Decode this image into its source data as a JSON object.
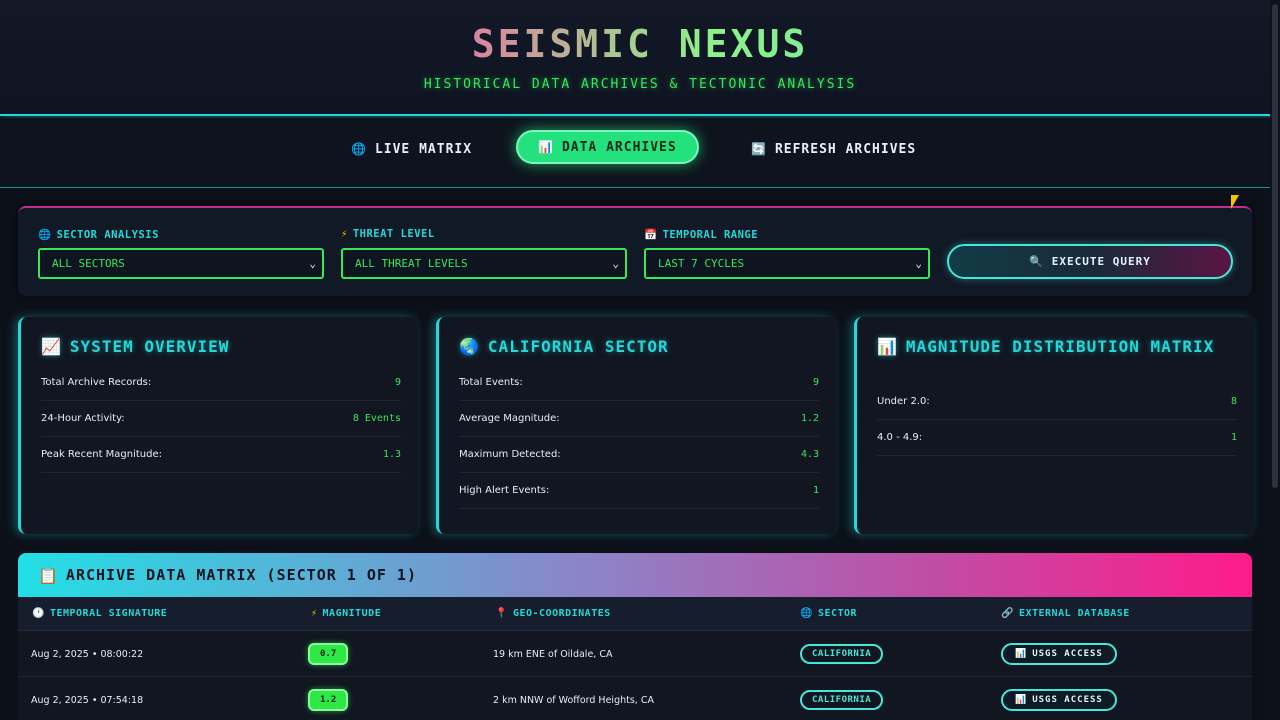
{
  "header": {
    "title": "SEISMIC NEXUS",
    "subtitle": "HISTORICAL DATA ARCHIVES & TECTONIC ANALYSIS"
  },
  "tabs": [
    {
      "label": "LIVE MATRIX",
      "icon": "globe-icon",
      "glyph": "🌐"
    },
    {
      "label": "DATA ARCHIVES",
      "icon": "chart-icon",
      "glyph": "📊"
    },
    {
      "label": "REFRESH ARCHIVES",
      "icon": "refresh-icon",
      "glyph": "🔄"
    }
  ],
  "filters": {
    "sector_label": "SECTOR ANALYSIS",
    "sector_value": "ALL SECTORS",
    "threat_label": "THREAT LEVEL",
    "threat_value": "ALL THREAT LEVELS",
    "range_label": "TEMPORAL RANGE",
    "range_value": "LAST 7 CYCLES",
    "execute_label": "EXECUTE QUERY"
  },
  "cards": {
    "overview": {
      "title": "SYSTEM OVERVIEW",
      "rows": [
        {
          "label": "Total Archive Records:",
          "value": "9"
        },
        {
          "label": "24-Hour Activity:",
          "value": "8 Events"
        },
        {
          "label": "Peak Recent Magnitude:",
          "value": "1.3"
        }
      ]
    },
    "california": {
      "title": "CALIFORNIA SECTOR",
      "rows": [
        {
          "label": "Total Events:",
          "value": "9"
        },
        {
          "label": "Average Magnitude:",
          "value": "1.2"
        },
        {
          "label": "Maximum Detected:",
          "value": "4.3"
        },
        {
          "label": "High Alert Events:",
          "value": "1"
        }
      ]
    },
    "distribution": {
      "title": "MAGNITUDE DISTRIBUTION MATRIX",
      "rows": [
        {
          "label": "Under 2.0:",
          "value": "8"
        },
        {
          "label": "4.0 - 4.9:",
          "value": "1"
        }
      ]
    }
  },
  "archive": {
    "title": "ARCHIVE DATA MATRIX (SECTOR 1 OF 1)",
    "columns": [
      "TEMPORAL SIGNATURE",
      "MAGNITUDE",
      "GEO-COORDINATES",
      "SECTOR",
      "EXTERNAL DATABASE"
    ],
    "rows": [
      {
        "time": "Aug 2, 2025 • 08:00:22",
        "magnitude": "0.7",
        "location": "19 km ENE of Oildale, CA",
        "sector": "CALIFORNIA",
        "link": "USGS ACCESS"
      },
      {
        "time": "Aug 2, 2025 • 07:54:18",
        "magnitude": "1.2",
        "location": "2 km NNW of Wofford Heights, CA",
        "sector": "CALIFORNIA",
        "link": "USGS ACCESS"
      }
    ]
  },
  "colors": {
    "accent_cyan": "#22d8d8",
    "accent_green": "#35e85a",
    "accent_pink": "#ff1b8a"
  }
}
